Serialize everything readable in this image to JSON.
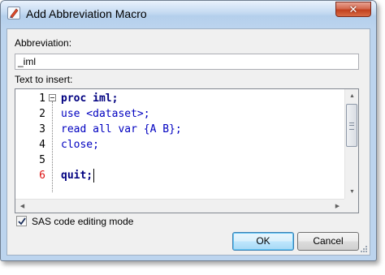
{
  "window": {
    "title": "Add Abbreviation Macro",
    "close_glyph": "✕"
  },
  "form": {
    "abbreviation_label": "Abbreviation:",
    "abbreviation_value": "_iml",
    "text_label": "Text to insert:"
  },
  "editor": {
    "line_numbers": [
      "1",
      "2",
      "3",
      "4",
      "5",
      "6"
    ],
    "current_line": 6,
    "lines": [
      [
        {
          "text": "proc iml;",
          "style": "keyword"
        }
      ],
      [
        {
          "text": "use <dataset>;",
          "style": "statement"
        }
      ],
      [
        {
          "text": "read all var {A B};",
          "style": "statement"
        }
      ],
      [
        {
          "text": "close;",
          "style": "statement"
        }
      ],
      [
        {
          "text": "",
          "style": "statement"
        }
      ],
      [
        {
          "text": "quit;",
          "style": "keyword"
        }
      ]
    ]
  },
  "options": {
    "sas_mode_label": "SAS code editing mode",
    "sas_mode_checked": true
  },
  "buttons": {
    "ok": "OK",
    "cancel": "Cancel"
  },
  "icons": {
    "app": "sas-pencil-icon",
    "close": "close-icon",
    "fold": "collapse-minus-icon",
    "scroll_up": "triangle-up-icon",
    "scroll_down": "triangle-down-icon",
    "scroll_left": "triangle-left-icon",
    "scroll_right": "triangle-right-icon",
    "checkmark": "checkmark-icon",
    "resize": "resize-grip-icon"
  },
  "colors": {
    "keyword": "#000080",
    "statement": "#0000c0",
    "current_line_number": "#dd1111",
    "window_frame": "#bcd4ee"
  }
}
